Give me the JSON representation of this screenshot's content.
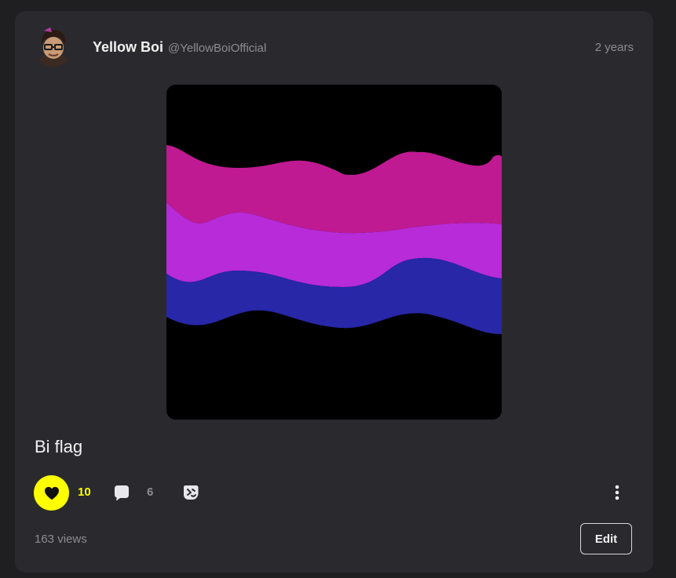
{
  "post": {
    "author_name": "Yellow Boi",
    "author_handle": "@YellowBoiOfficial",
    "time_ago": "2 years",
    "title": "Bi flag",
    "likes": "10",
    "comments": "6",
    "views": "163 views",
    "edit_label": "Edit",
    "liked": true
  },
  "icons": {
    "avatar": "user-avatar",
    "like": "heart-icon",
    "comment": "speech-bubble-icon",
    "remix": "remix-icon",
    "more": "vertical-ellipsis-icon"
  },
  "colors": {
    "accent": "#ffff00",
    "card_background": "#2a2a2e",
    "page_background": "#1f1f22",
    "flag_magenta": "#bf1a92",
    "flag_purple": "#b82bd9",
    "flag_blue": "#2727a8"
  }
}
